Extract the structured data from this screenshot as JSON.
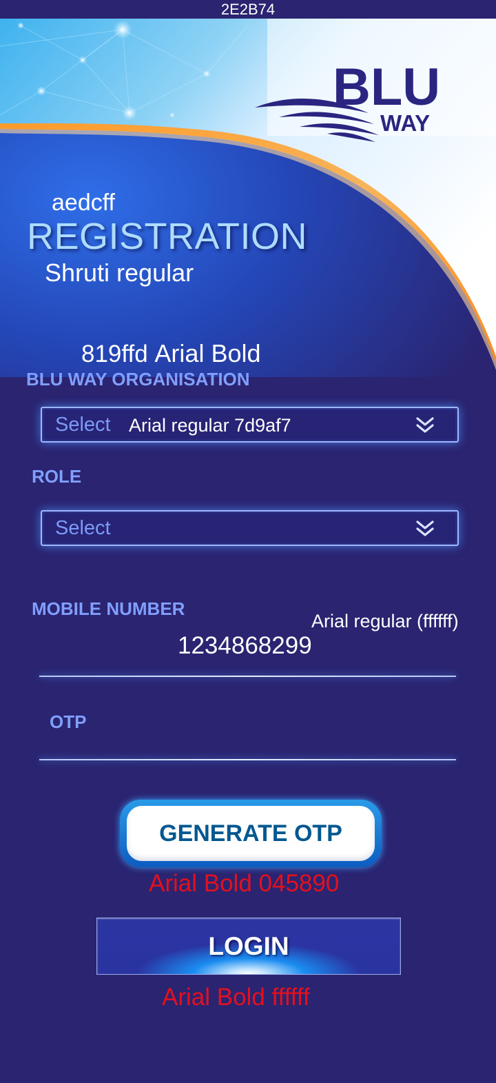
{
  "top_strip": {
    "text": "2E2B74"
  },
  "brand": {
    "line1": "BLU",
    "line2": "WAY"
  },
  "header": {
    "note_color": "aedcff",
    "title": "REGISTRATION",
    "note_font": "Shruti regular"
  },
  "organisation": {
    "note_prefix": "819ffd",
    "note_suffix": "Arial Bold",
    "label": "BLU WAY ORGANISATION",
    "placeholder": "Select",
    "note": "Arial regular 7d9af7"
  },
  "role": {
    "label": "ROLE",
    "placeholder": "Select"
  },
  "mobile": {
    "label": "MOBILE NUMBER",
    "note": "Arial regular (ffffff)",
    "value": "1234868299"
  },
  "otp": {
    "label": "OTP"
  },
  "buttons": {
    "generate_otp": "GENERATE OTP",
    "generate_note": "Arial Bold 045890",
    "login": "LOGIN",
    "login_note": "Arial Bold ffffff"
  },
  "colors": {
    "background": "#2E2B74",
    "title": "#aedcff",
    "label": "#819ffd",
    "placeholder": "#7d9af7",
    "otp_button_text": "#045890",
    "spec_note": "#e4101d",
    "accent_orange": "#f7902a"
  },
  "icons": {
    "dropdown": "double-chevron-down-icon",
    "network": "network-glow-art"
  }
}
